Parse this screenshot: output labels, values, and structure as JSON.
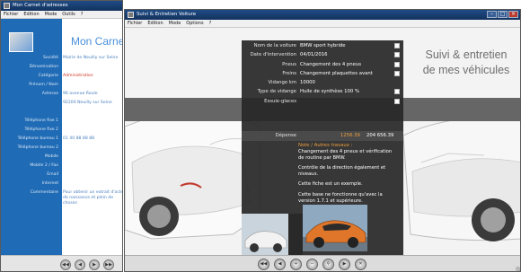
{
  "back_window": {
    "title": "Mon Carnet d'adresses",
    "menu": [
      "Fichier",
      "Edition",
      "Mode",
      "Outils",
      "?"
    ],
    "header_title": "Mon Carnet",
    "labels": [
      "Société",
      "Dénomination",
      "Catégorie",
      "Prénom / Nom",
      "Adresse",
      "",
      "",
      "Téléphone fixe 1",
      "Téléphone fixe 2",
      "Téléphone bureau 1",
      "Téléphone bureau 2",
      "Mobile",
      "Mobile 2 / Fax",
      "Email",
      "Internet",
      "Commentaire"
    ],
    "values": {
      "societe": "Mairie de Neuilly sur Seine",
      "categorie": "Administration",
      "adresse1": "96 avenue Roule",
      "adresse2": "92200 Neuilly sur Seine",
      "tel_bureau1": "01 40 88 88 88",
      "commentaire": "Pour obtenir un extrait d'acte de naissance et plein de choses"
    }
  },
  "front_window": {
    "title": "Suivi & Entretien Voiture",
    "menu": [
      "Fichier",
      "Edition",
      "Mode",
      "Options",
      "?"
    ],
    "hero_title_line1": "Suivi & entretien",
    "hero_title_line2": "de mes véhicules",
    "fields": [
      {
        "label": "Nom de la voiture",
        "value": "BMW sport hybride"
      },
      {
        "label": "Date d'intervention",
        "value": "04/01/2016"
      },
      {
        "label": "Pneus",
        "value": "Changement des 4 pneus"
      },
      {
        "label": "Freins",
        "value": "Changement plaquettes avant"
      },
      {
        "label": "Vidange km",
        "value": "10000"
      },
      {
        "label": "Type de vidange",
        "value": "Huile de synthèse 100 %"
      },
      {
        "label": "Essuie-glaces",
        "value": ""
      }
    ],
    "depense_label": "Dépense",
    "depense_value": "1256.39",
    "depense_total": "204 656.39",
    "notes_header": "Note / Autres travaux :",
    "notes": [
      "Changement des 4 pneus et vérification de routine par BMW.",
      "Contrôle de la direction également et niveaux.",
      "Cette fiche est un exemple.",
      "Cette base ne fonctionne qu'avec la version 1.7.1 et supérieure."
    ]
  },
  "colors": {
    "accent_blue": "#1f6bb5",
    "orange": "#f0a040",
    "panel": "#282828"
  }
}
